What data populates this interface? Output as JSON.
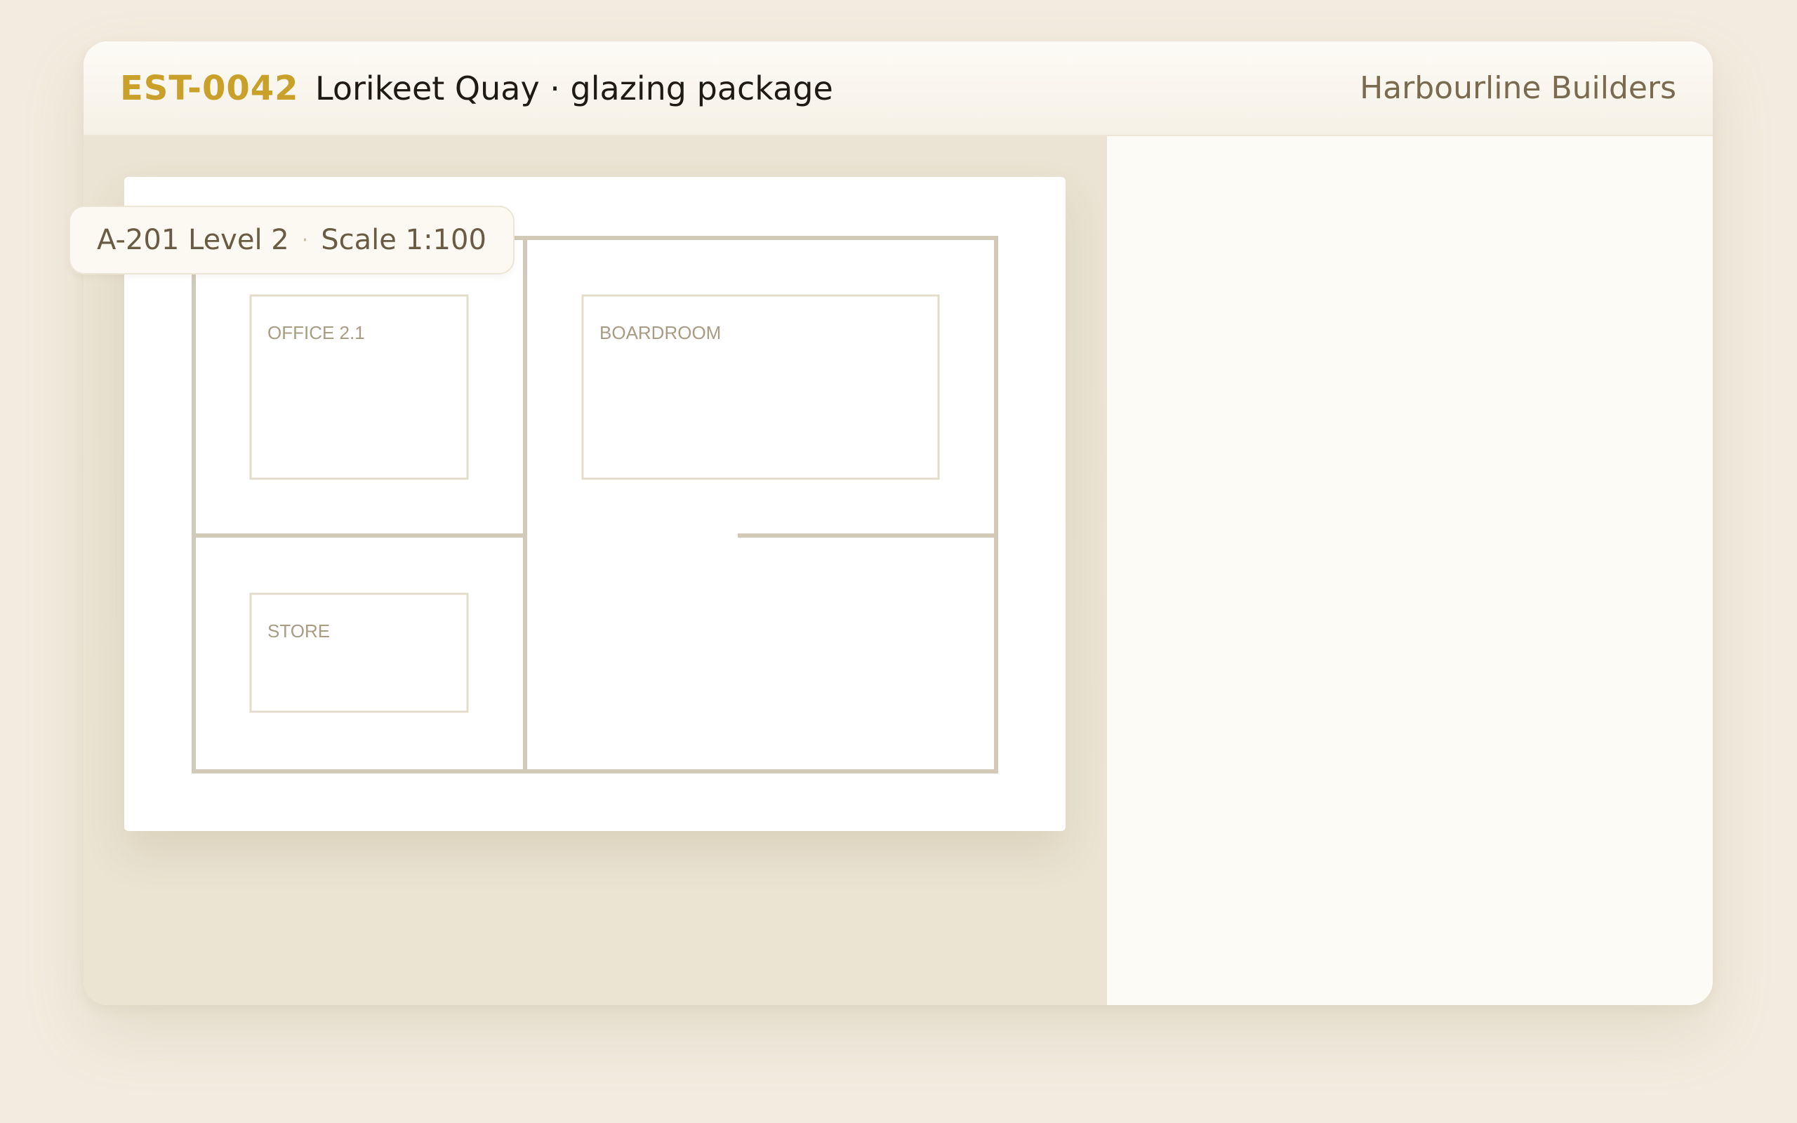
{
  "header": {
    "estimate_id": "EST-0042",
    "project_title": "Lorikeet Quay · glazing package",
    "client": "Harbourline Builders"
  },
  "sheet": {
    "code": "A-201 Level 2",
    "separator": "·",
    "scale": "Scale 1:100"
  },
  "rooms": {
    "office": "OFFICE 2.1",
    "boardroom": "BOARDROOM",
    "store": "STORE"
  },
  "colors": {
    "accent": "#c9a02a",
    "wall": "#d3c9b8",
    "room_outline": "#e3dccd",
    "canvas": "#ebe3d3",
    "panel": "#fcfbf6"
  }
}
